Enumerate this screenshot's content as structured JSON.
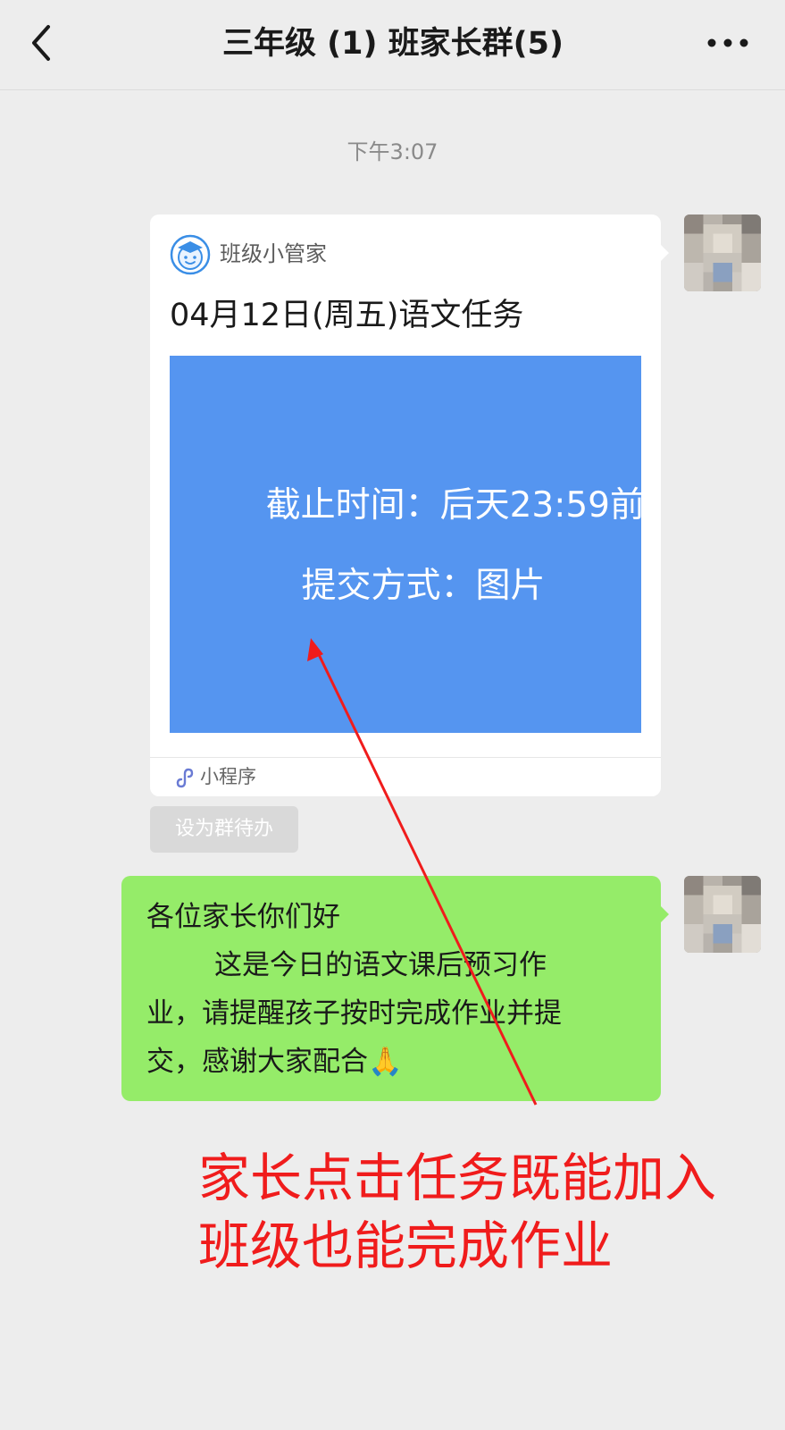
{
  "header": {
    "title": "三年级 (1) 班家长群(5)",
    "back_icon": "chevron-left-icon",
    "more_icon": "more-dots-icon"
  },
  "timestamp": "下午3:07",
  "task_card": {
    "app_name": "班级小管家",
    "app_icon": "graduate-face-icon",
    "title": "04月12日(周五)语文任务",
    "deadline": "截止时间：后天23:59前",
    "submit_method": "提交方式：图片",
    "image_color": "#5595f0",
    "footer_label": "小程序",
    "footer_icon": "mini-program-icon"
  },
  "todo_button": {
    "label": "设为群待办"
  },
  "text_message": {
    "line1": "各位家长你们好",
    "line2": "这是今日的语文课后预习作",
    "line3": "业，请提醒孩子按时完成作业并提",
    "line4": "交，感谢大家配合",
    "emoji": "🙏",
    "bubble_color": "#95ec69"
  },
  "annotation": {
    "line1": "家长点击任务既能加入",
    "line2": "班级也能完成作业",
    "color": "#f01c1c"
  }
}
